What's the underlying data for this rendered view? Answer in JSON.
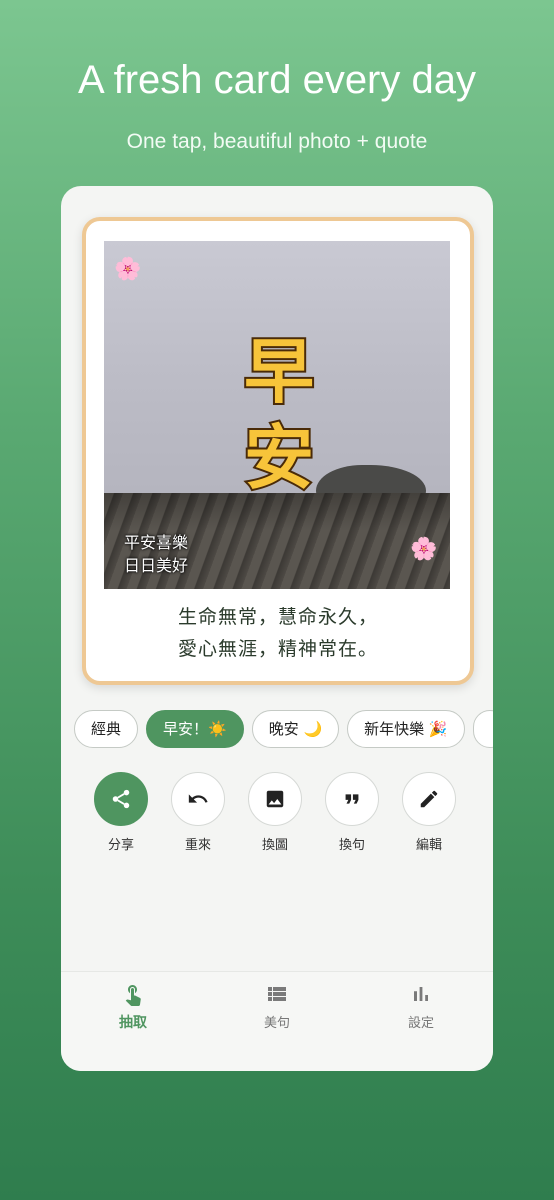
{
  "headline": "A fresh card every day",
  "subline": "One tap, beautiful photo + quote",
  "card": {
    "big_title_line1": "早",
    "big_title_line2": "安",
    "caption_line1": "平安喜樂",
    "caption_line2": "日日美好",
    "quote_line1": "生命無常，慧命永久，",
    "quote_line2": "愛心無涯，精神常在。",
    "flower_top": "🌸",
    "flower_bottom": "🌸"
  },
  "chips": [
    {
      "label": "經典"
    },
    {
      "label": "早安！☀️",
      "active": true
    },
    {
      "label": "晚安 🌙"
    },
    {
      "label": "新年快樂 🎉"
    },
    {
      "label": ""
    }
  ],
  "actions": [
    {
      "label": "分享",
      "icon": "share-icon"
    },
    {
      "label": "重來",
      "icon": "undo-icon"
    },
    {
      "label": "換圖",
      "icon": "image-icon"
    },
    {
      "label": "換句",
      "icon": "quote-icon"
    },
    {
      "label": "編輯",
      "icon": "pencil-icon"
    }
  ],
  "nav": [
    {
      "label": "抽取",
      "icon": "tap-hand-icon",
      "active": true
    },
    {
      "label": "美句",
      "icon": "list-icon"
    },
    {
      "label": "設定",
      "icon": "bar-chart-icon"
    }
  ],
  "colors": {
    "accent": "#4f9560",
    "card_border": "#eec894",
    "title_fill": "#f7c43a"
  }
}
